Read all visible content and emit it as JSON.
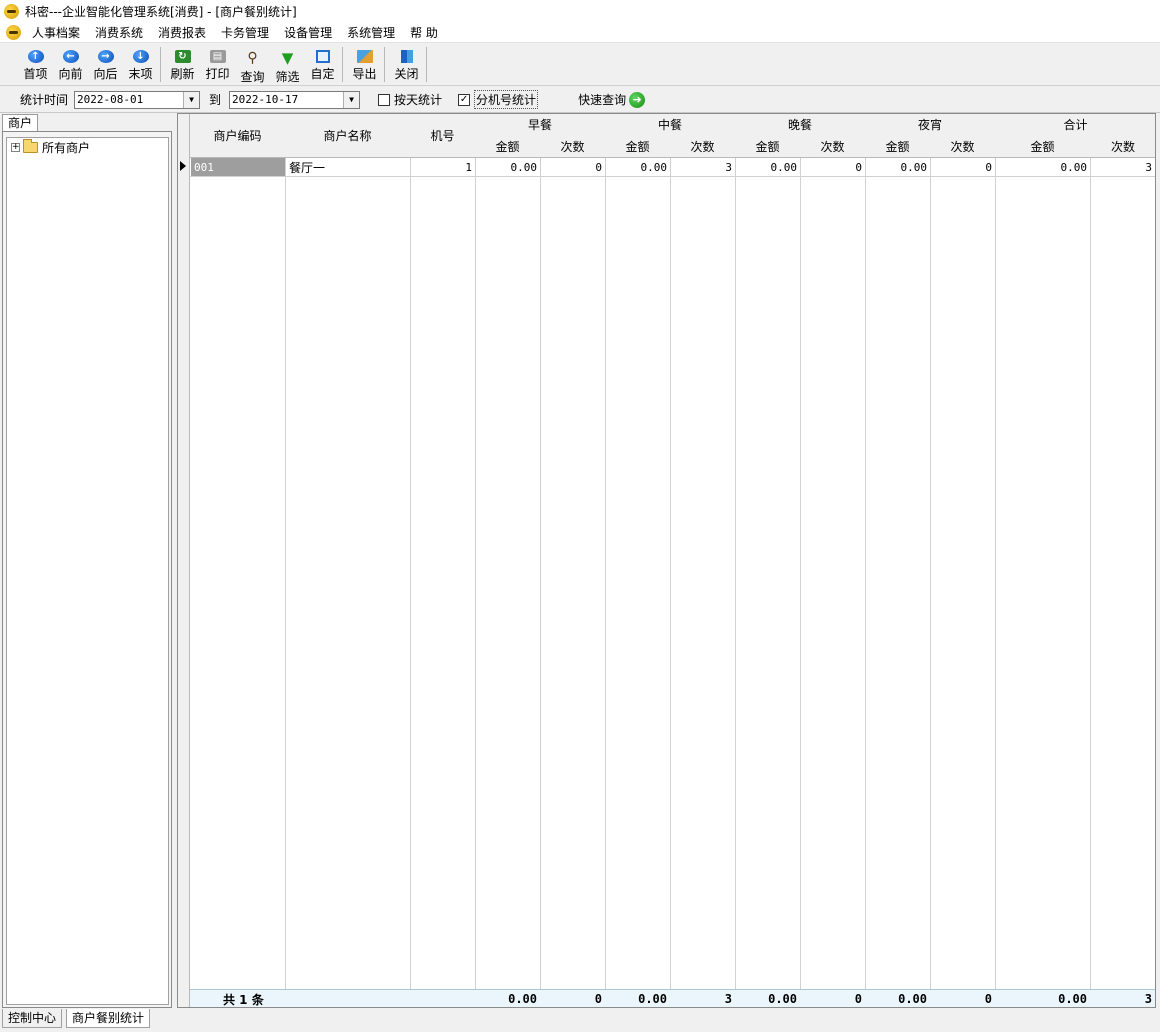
{
  "window": {
    "title": "科密---企业智能化管理系统[消费] - [商户餐别统计]"
  },
  "menu": [
    "人事档案",
    "消费系统",
    "消费报表",
    "卡务管理",
    "设备管理",
    "系统管理",
    "帮 助"
  ],
  "toolbar": {
    "first": "首项",
    "prev": "向前",
    "next": "向后",
    "last": "末项",
    "refresh": "刷新",
    "print": "打印",
    "query": "查询",
    "filter": "筛选",
    "custom": "自定",
    "export": "导出",
    "close": "关闭"
  },
  "filter": {
    "time_label": "统计时间",
    "from_date": "2022-08-01",
    "to_label": "到",
    "to_date": "2022-10-17",
    "by_day_label": "按天统计",
    "by_day_checked": false,
    "by_machine_label": "分机号统计",
    "by_machine_checked": true,
    "quick_query": "快速查询"
  },
  "left_panel": {
    "tab": "商户",
    "tree_root": "所有商户"
  },
  "grid": {
    "headers": {
      "merchant_code": "商户编码",
      "merchant_name": "商户名称",
      "machine_no": "机号",
      "breakfast": "早餐",
      "lunch": "中餐",
      "dinner": "晚餐",
      "midnight": "夜宵",
      "total": "合计",
      "amount": "金额",
      "count": "次数"
    },
    "rows": [
      {
        "code": "001",
        "name": "餐厅一",
        "machine": "1",
        "b_amt": "0.00",
        "b_cnt": "0",
        "l_amt": "0.00",
        "l_cnt": "3",
        "d_amt": "0.00",
        "d_cnt": "0",
        "n_amt": "0.00",
        "n_cnt": "0",
        "t_amt": "0.00",
        "t_cnt": "3"
      }
    ],
    "footer": {
      "label": "共 1 条",
      "b_amt": "0.00",
      "b_cnt": "0",
      "l_amt": "0.00",
      "l_cnt": "3",
      "d_amt": "0.00",
      "d_cnt": "0",
      "n_amt": "0.00",
      "n_cnt": "0",
      "t_amt": "0.00",
      "t_cnt": "3"
    }
  },
  "bottom_tabs": [
    "控制中心",
    "商户餐别统计"
  ]
}
